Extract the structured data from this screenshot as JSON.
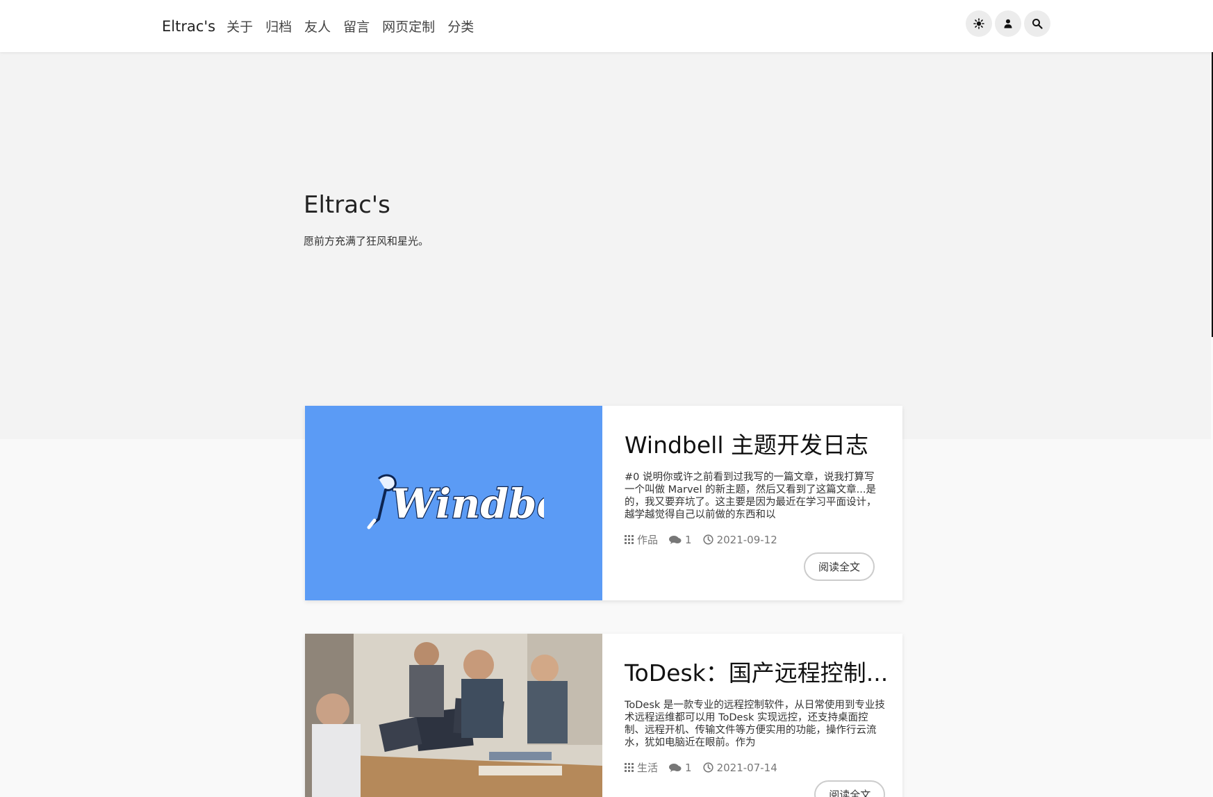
{
  "nav": {
    "brand": "Eltrac's",
    "links": [
      "关于",
      "归档",
      "友人",
      "留言",
      "网页定制",
      "分类"
    ],
    "actions": [
      "theme-toggle",
      "user-account",
      "search"
    ]
  },
  "hero": {
    "title": "Eltrac's",
    "subtitle": "愿前方充满了狂风和星光。"
  },
  "posts": [
    {
      "title": "Windbell 主题开发日志",
      "excerpt": "#0 说明你或许之前看到过我写的一篇文章，说我打算写一个叫做 Marvel 的新主题，然后又看到了这篇文章...是的，我又要弃坑了。这主要是因为最近在学习平面设计，越学越觉得自己以前做的东西和以",
      "category": "作品",
      "comments": "1",
      "date": "2021-09-12",
      "read_label": "阅读全文",
      "thumb_text": "Windbell",
      "thumb_color": "#5b9bf5"
    },
    {
      "title": "ToDesk：国产远程控制...",
      "excerpt": "ToDesk 是一款专业的远程控制软件，从日常使用到专业技术远程运维都可以用 ToDesk 实现远控，还支持桌面控制、远程开机、传输文件等方便实用的功能，操作行云流水，犹如电脑近在眼前。作为",
      "category": "生活",
      "comments": "1",
      "date": "2021-07-14",
      "read_label": "阅读全文"
    }
  ]
}
